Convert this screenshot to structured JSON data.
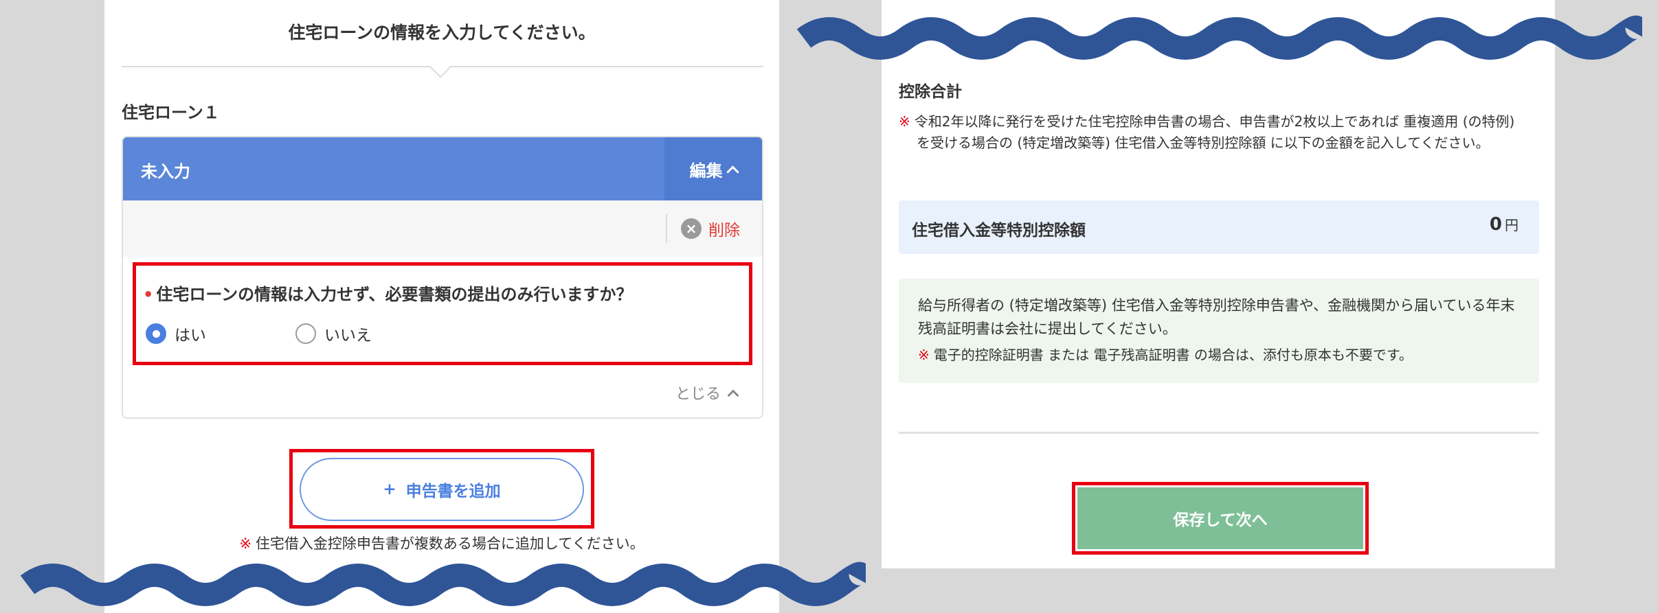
{
  "colors": {
    "background": "#d8d8d8",
    "header_blue": "#5b86d9",
    "highlight_red": "#e60012",
    "save_green": "#7fbf98",
    "wave_blue": "#2f5597"
  },
  "left": {
    "heading": "住宅ローンの情報を入力してください。",
    "loan_title": "住宅ローン１",
    "card": {
      "status": "未入力",
      "edit_label": "編集",
      "delete_label": "削除",
      "question": {
        "required_mark": "•",
        "text": "住宅ローンの情報は入力せず、必要書類の提出のみ行いますか？",
        "options": [
          {
            "label": "はい",
            "selected": true
          },
          {
            "label": "いいえ",
            "selected": false
          }
        ]
      },
      "close_label": "とじる"
    },
    "add_button": {
      "icon": "plus-icon",
      "label": "申告書を追加"
    },
    "add_note_mark": "※",
    "add_note": "住宅借入金控除申告書が複数ある場合に追加してください。"
  },
  "right": {
    "title": "控除合計",
    "note_mark": "※",
    "note": "令和2年以降に発行を受けた住宅控除申告書の場合、申告書が2枚以上であれば 重複適用 (の特例) を受ける場合の (特定増改築等) 住宅借入金等特別控除額 に以下の金額を記入してください。",
    "deduction": {
      "label": "住宅借入金等特別控除額",
      "value": "0",
      "unit": "円"
    },
    "info_text": "給与所得者の (特定増改築等) 住宅借入金等特別控除申告書や、金融機関から届いている年末残高証明書は会社に提出してください。",
    "info_note_mark": "※",
    "info_note": "電子的控除証明書 または 電子残高証明書 の場合は、添付も原本も不要です。",
    "save_button": "保存して次へ"
  }
}
